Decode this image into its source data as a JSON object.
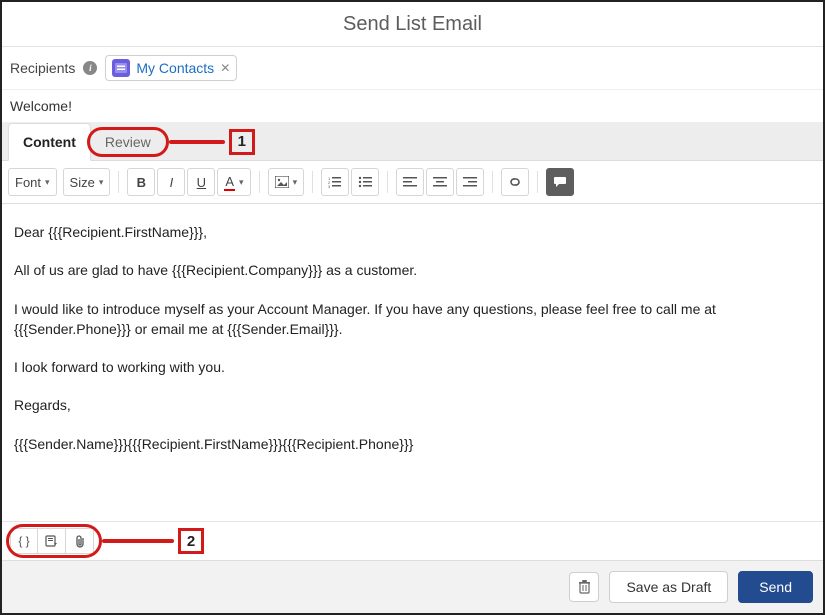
{
  "header": {
    "title": "Send List Email"
  },
  "recipients": {
    "label": "Recipients",
    "chip": {
      "label": "My Contacts"
    }
  },
  "subject": {
    "value": "Welcome!"
  },
  "tabs": {
    "content": "Content",
    "review": "Review"
  },
  "toolbar": {
    "font": "Font",
    "size": "Size"
  },
  "callouts": {
    "one": "1",
    "two": "2"
  },
  "body": {
    "p1": "Dear {{{Recipient.FirstName}}},",
    "p2": "All of us are glad to have {{{Recipient.Company}}} as a customer.",
    "p3": "I would like to introduce myself as your Account Manager.  If you have any questions, please feel free to call me at {{{Sender.Phone}}} or email me at {{{Sender.Email}}}.",
    "p4": "I look forward to working with you.",
    "p5": "Regards,",
    "p6": "{{{Sender.Name}}}{{{Recipient.FirstName}}}{{{Recipient.Phone}}}"
  },
  "footer": {
    "save_draft": "Save as Draft",
    "send": "Send"
  }
}
